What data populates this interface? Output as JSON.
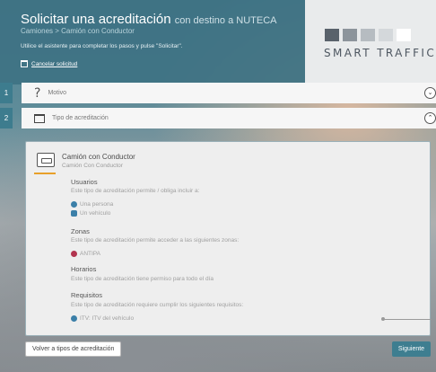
{
  "header": {
    "title": "Solicitar una acreditación",
    "destination": "con destino a NUTECA",
    "breadcrumb": "Camiones > Camión con Conductor",
    "instructions": "Utilice el asistente para completar los pasos y pulse \"Solicitar\".",
    "cancel_label": "Cancelar solicitud"
  },
  "brand": {
    "logo_text": "SMART TRAFFIC",
    "colors": [
      "#59626b",
      "#8c949b",
      "#b6bcc1",
      "#d4d8db",
      "#ffffff"
    ]
  },
  "steps": [
    {
      "number": "1",
      "label": "Motivo",
      "icon": "question-icon",
      "state": "collapsed"
    },
    {
      "number": "2",
      "label": "Tipo de acreditación",
      "icon": "document-icon",
      "state": "expanded"
    }
  ],
  "accreditation": {
    "title": "Camión con Conductor",
    "subtitle": "Camión Con Conductor",
    "users_heading": "Usuarios",
    "users_desc": "Este tipo de acreditación permite / obliga incluir a:",
    "users_items": [
      "Una persona",
      "Un vehículo"
    ],
    "zones_heading": "Zonas",
    "zones_desc": "Este tipo de acreditación permite acceder a las siguientes zonas:",
    "zones_items": [
      "ANTIPA"
    ],
    "schedule_heading": "Horarios",
    "schedule_desc": "Este tipo de acreditación tiene permiso para todo el día",
    "requirements_heading": "Requisitos",
    "requirements_desc": "Este tipo de acreditación requiere cumplir los siguientes requisitos:",
    "requirements_items": [
      "ITV: ITV del vehículo"
    ]
  },
  "footer": {
    "back_label": "Volver a tipos de acreditación",
    "next_label": "Siguiente"
  },
  "colors": {
    "accent": "#3e7e90",
    "highlight": "#e8a02a",
    "zone_pin": "#b2344f",
    "user_icon": "#3b7fa8"
  }
}
